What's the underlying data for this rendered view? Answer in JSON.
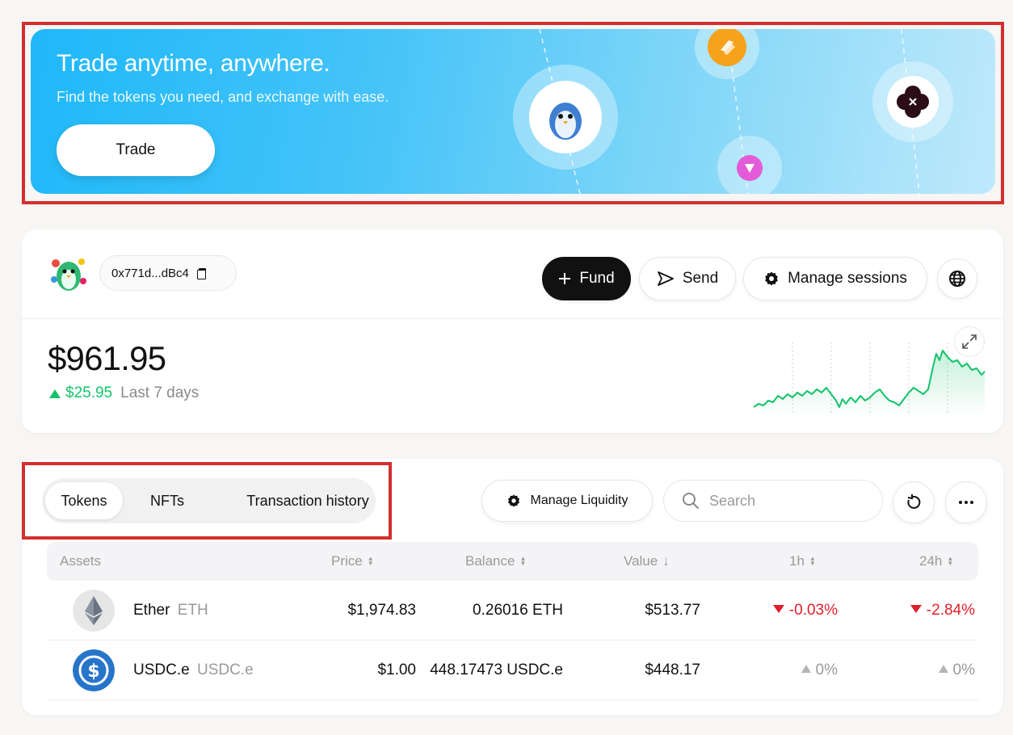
{
  "banner": {
    "title": "Trade anytime, anywhere.",
    "subtitle": "Find the tokens you need, and exchange with ease.",
    "button_label": "Trade"
  },
  "account": {
    "address": "0x771d...dBc4",
    "fund_label": "Fund",
    "send_label": "Send",
    "sessions_label": "Manage sessions",
    "balance": "$961.95",
    "change": "$25.95",
    "change_period": "Last 7 days",
    "positive_color": "#16c36b"
  },
  "assets": {
    "tabs": [
      {
        "label": "Tokens",
        "active": true
      },
      {
        "label": "NFTs",
        "active": false
      },
      {
        "label": "Transaction history",
        "active": false
      }
    ],
    "manage_liquidity_label": "Manage Liquidity",
    "search_placeholder": "Search",
    "columns": {
      "assets": "Assets",
      "price": "Price",
      "balance": "Balance",
      "value": "Value",
      "h1": "1h",
      "h24": "24h"
    },
    "rows": [
      {
        "name": "Ether",
        "symbol": "ETH",
        "price": "$1,974.83",
        "balance": "0.26016 ETH",
        "value": "$513.77",
        "change_1h": "-0.03%",
        "change_24h": "-2.84%"
      },
      {
        "name": "USDC.e",
        "symbol": "USDC.e",
        "price": "$1.00",
        "balance": "448.17473 USDC.e",
        "value": "$448.17",
        "change_1h": "0%",
        "change_24h": "0%"
      }
    ],
    "negative_color": "#e0202a"
  }
}
